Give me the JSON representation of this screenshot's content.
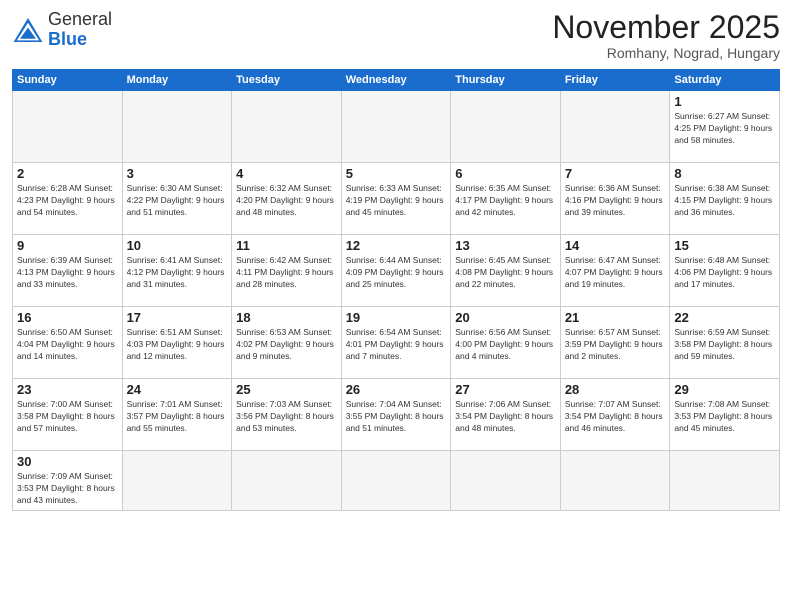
{
  "header": {
    "logo_general": "General",
    "logo_blue": "Blue",
    "title": "November 2025",
    "location": "Romhany, Nograd, Hungary"
  },
  "weekdays": [
    "Sunday",
    "Monday",
    "Tuesday",
    "Wednesday",
    "Thursday",
    "Friday",
    "Saturday"
  ],
  "weeks": [
    [
      {
        "day": "",
        "info": ""
      },
      {
        "day": "",
        "info": ""
      },
      {
        "day": "",
        "info": ""
      },
      {
        "day": "",
        "info": ""
      },
      {
        "day": "",
        "info": ""
      },
      {
        "day": "",
        "info": ""
      },
      {
        "day": "1",
        "info": "Sunrise: 6:27 AM\nSunset: 4:25 PM\nDaylight: 9 hours\nand 58 minutes."
      }
    ],
    [
      {
        "day": "2",
        "info": "Sunrise: 6:28 AM\nSunset: 4:23 PM\nDaylight: 9 hours\nand 54 minutes."
      },
      {
        "day": "3",
        "info": "Sunrise: 6:30 AM\nSunset: 4:22 PM\nDaylight: 9 hours\nand 51 minutes."
      },
      {
        "day": "4",
        "info": "Sunrise: 6:32 AM\nSunset: 4:20 PM\nDaylight: 9 hours\nand 48 minutes."
      },
      {
        "day": "5",
        "info": "Sunrise: 6:33 AM\nSunset: 4:19 PM\nDaylight: 9 hours\nand 45 minutes."
      },
      {
        "day": "6",
        "info": "Sunrise: 6:35 AM\nSunset: 4:17 PM\nDaylight: 9 hours\nand 42 minutes."
      },
      {
        "day": "7",
        "info": "Sunrise: 6:36 AM\nSunset: 4:16 PM\nDaylight: 9 hours\nand 39 minutes."
      },
      {
        "day": "8",
        "info": "Sunrise: 6:38 AM\nSunset: 4:15 PM\nDaylight: 9 hours\nand 36 minutes."
      }
    ],
    [
      {
        "day": "9",
        "info": "Sunrise: 6:39 AM\nSunset: 4:13 PM\nDaylight: 9 hours\nand 33 minutes."
      },
      {
        "day": "10",
        "info": "Sunrise: 6:41 AM\nSunset: 4:12 PM\nDaylight: 9 hours\nand 31 minutes."
      },
      {
        "day": "11",
        "info": "Sunrise: 6:42 AM\nSunset: 4:11 PM\nDaylight: 9 hours\nand 28 minutes."
      },
      {
        "day": "12",
        "info": "Sunrise: 6:44 AM\nSunset: 4:09 PM\nDaylight: 9 hours\nand 25 minutes."
      },
      {
        "day": "13",
        "info": "Sunrise: 6:45 AM\nSunset: 4:08 PM\nDaylight: 9 hours\nand 22 minutes."
      },
      {
        "day": "14",
        "info": "Sunrise: 6:47 AM\nSunset: 4:07 PM\nDaylight: 9 hours\nand 19 minutes."
      },
      {
        "day": "15",
        "info": "Sunrise: 6:48 AM\nSunset: 4:06 PM\nDaylight: 9 hours\nand 17 minutes."
      }
    ],
    [
      {
        "day": "16",
        "info": "Sunrise: 6:50 AM\nSunset: 4:04 PM\nDaylight: 9 hours\nand 14 minutes."
      },
      {
        "day": "17",
        "info": "Sunrise: 6:51 AM\nSunset: 4:03 PM\nDaylight: 9 hours\nand 12 minutes."
      },
      {
        "day": "18",
        "info": "Sunrise: 6:53 AM\nSunset: 4:02 PM\nDaylight: 9 hours\nand 9 minutes."
      },
      {
        "day": "19",
        "info": "Sunrise: 6:54 AM\nSunset: 4:01 PM\nDaylight: 9 hours\nand 7 minutes."
      },
      {
        "day": "20",
        "info": "Sunrise: 6:56 AM\nSunset: 4:00 PM\nDaylight: 9 hours\nand 4 minutes."
      },
      {
        "day": "21",
        "info": "Sunrise: 6:57 AM\nSunset: 3:59 PM\nDaylight: 9 hours\nand 2 minutes."
      },
      {
        "day": "22",
        "info": "Sunrise: 6:59 AM\nSunset: 3:58 PM\nDaylight: 8 hours\nand 59 minutes."
      }
    ],
    [
      {
        "day": "23",
        "info": "Sunrise: 7:00 AM\nSunset: 3:58 PM\nDaylight: 8 hours\nand 57 minutes."
      },
      {
        "day": "24",
        "info": "Sunrise: 7:01 AM\nSunset: 3:57 PM\nDaylight: 8 hours\nand 55 minutes."
      },
      {
        "day": "25",
        "info": "Sunrise: 7:03 AM\nSunset: 3:56 PM\nDaylight: 8 hours\nand 53 minutes."
      },
      {
        "day": "26",
        "info": "Sunrise: 7:04 AM\nSunset: 3:55 PM\nDaylight: 8 hours\nand 51 minutes."
      },
      {
        "day": "27",
        "info": "Sunrise: 7:06 AM\nSunset: 3:54 PM\nDaylight: 8 hours\nand 48 minutes."
      },
      {
        "day": "28",
        "info": "Sunrise: 7:07 AM\nSunset: 3:54 PM\nDaylight: 8 hours\nand 46 minutes."
      },
      {
        "day": "29",
        "info": "Sunrise: 7:08 AM\nSunset: 3:53 PM\nDaylight: 8 hours\nand 45 minutes."
      }
    ],
    [
      {
        "day": "30",
        "info": "Sunrise: 7:09 AM\nSunset: 3:53 PM\nDaylight: 8 hours\nand 43 minutes."
      },
      {
        "day": "",
        "info": ""
      },
      {
        "day": "",
        "info": ""
      },
      {
        "day": "",
        "info": ""
      },
      {
        "day": "",
        "info": ""
      },
      {
        "day": "",
        "info": ""
      },
      {
        "day": "",
        "info": ""
      }
    ]
  ]
}
